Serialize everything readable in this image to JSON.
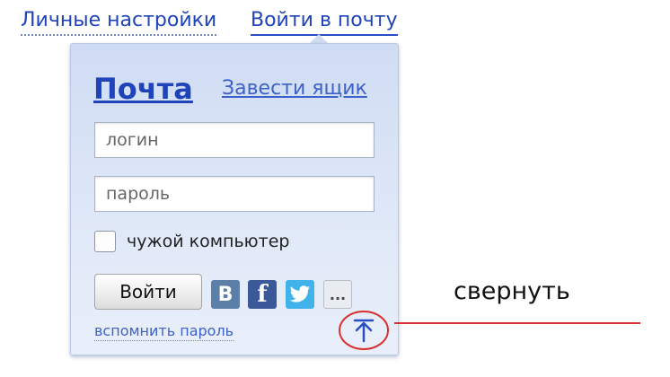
{
  "header": {
    "personal_settings": "Личные настройки",
    "login_mail": "Войти в почту"
  },
  "panel": {
    "title": "Почта",
    "create_box": "Завести ящик",
    "login_placeholder": "логин",
    "password_placeholder": "пароль",
    "foreign_computer": "чужой компьютер",
    "login_button": "Войти",
    "social": {
      "vk": "B",
      "facebook": "f",
      "twitter_icon": "twitter-bird-icon",
      "more": "..."
    },
    "remember_password": "вспомнить пароль"
  },
  "annotation": {
    "collapse_label": "свернуть",
    "collapse_icon": "arrow-up-to-line-icon",
    "highlight_color": "#d8302f"
  },
  "colors": {
    "link": "#1f43b8",
    "panel_bg": "#dfe8f8"
  }
}
